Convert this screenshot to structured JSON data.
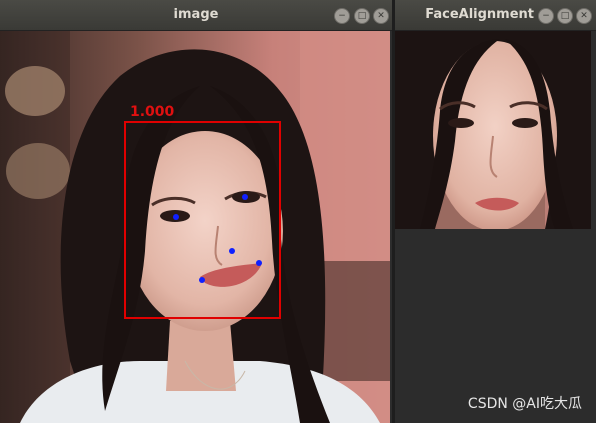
{
  "windows": {
    "image": {
      "title": "image",
      "detection": {
        "score": "1.000",
        "box_color": "#e00000"
      },
      "landmark_color": "#1020ff"
    },
    "face_alignment": {
      "title": "FaceAlignment"
    }
  },
  "controls": {
    "minimize": "−",
    "maximize": "□",
    "close": "✕"
  },
  "watermark": "CSDN @AI吃大瓜"
}
